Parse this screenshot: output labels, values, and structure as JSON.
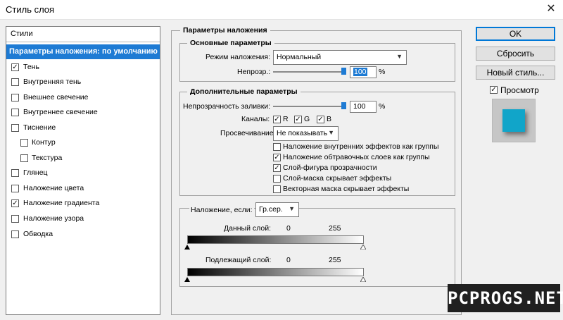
{
  "window": {
    "title": "Стиль слоя",
    "close_glyph": "✕"
  },
  "styles_panel": {
    "header": "Стили",
    "items": [
      {
        "label": "Параметры наложения: по умолчанию",
        "checked": null
      },
      {
        "label": "Тень",
        "checked": true
      },
      {
        "label": "Внутренняя тень",
        "checked": false
      },
      {
        "label": "Внешнее свечение",
        "checked": false
      },
      {
        "label": "Внутреннее свечение",
        "checked": false
      },
      {
        "label": "Тиснение",
        "checked": false
      },
      {
        "label": "Контур",
        "checked": false
      },
      {
        "label": "Текстура",
        "checked": false
      },
      {
        "label": "Глянец",
        "checked": false
      },
      {
        "label": "Наложение цвета",
        "checked": false
      },
      {
        "label": "Наложение градиента",
        "checked": true
      },
      {
        "label": "Наложение узора",
        "checked": false
      },
      {
        "label": "Обводка",
        "checked": false
      }
    ]
  },
  "blending": {
    "title": "Параметры наложения",
    "basic": {
      "title": "Основные параметры",
      "mode_label": "Режим наложения:",
      "mode_value": "Нормальный",
      "opacity_label": "Непрозр.:",
      "opacity_value": "100",
      "percent": "%"
    },
    "advanced": {
      "title": "Дополнительные параметры",
      "fill_label": "Непрозрачность заливки:",
      "fill_value": "100",
      "percent": "%",
      "channels_label": "Каналы:",
      "channel_r": "R",
      "channel_g": "G",
      "channel_b": "B",
      "knockout_label": "Просвечивание:",
      "knockout_value": "Не показывать",
      "options": [
        {
          "label": "Наложение внутренних эффектов как группы",
          "checked": false
        },
        {
          "label": "Наложение обтравочных слоев как группы",
          "checked": true
        },
        {
          "label": "Слой-фигура прозрачности",
          "checked": true
        },
        {
          "label": "Слой-маска скрывает эффекты",
          "checked": false
        },
        {
          "label": "Векторная маска скрывает эффекты",
          "checked": false
        }
      ]
    },
    "blend_if": {
      "label": "Наложение, если:",
      "value": "Гр.сер.",
      "this_layer_label": "Данный слой:",
      "this_layer_min": "0",
      "this_layer_max": "255",
      "underlying_label": "Подлежащий слой:",
      "underlying_min": "0",
      "underlying_max": "255"
    }
  },
  "buttons": {
    "ok": "OK",
    "cancel": "Сбросить",
    "new_style": "Новый стиль...",
    "preview_label": "Просмотр"
  },
  "watermark": "PCPROGS.NET",
  "colors": {
    "accent": "#1e7bd4",
    "preview_swatch": "#11a5c9"
  }
}
